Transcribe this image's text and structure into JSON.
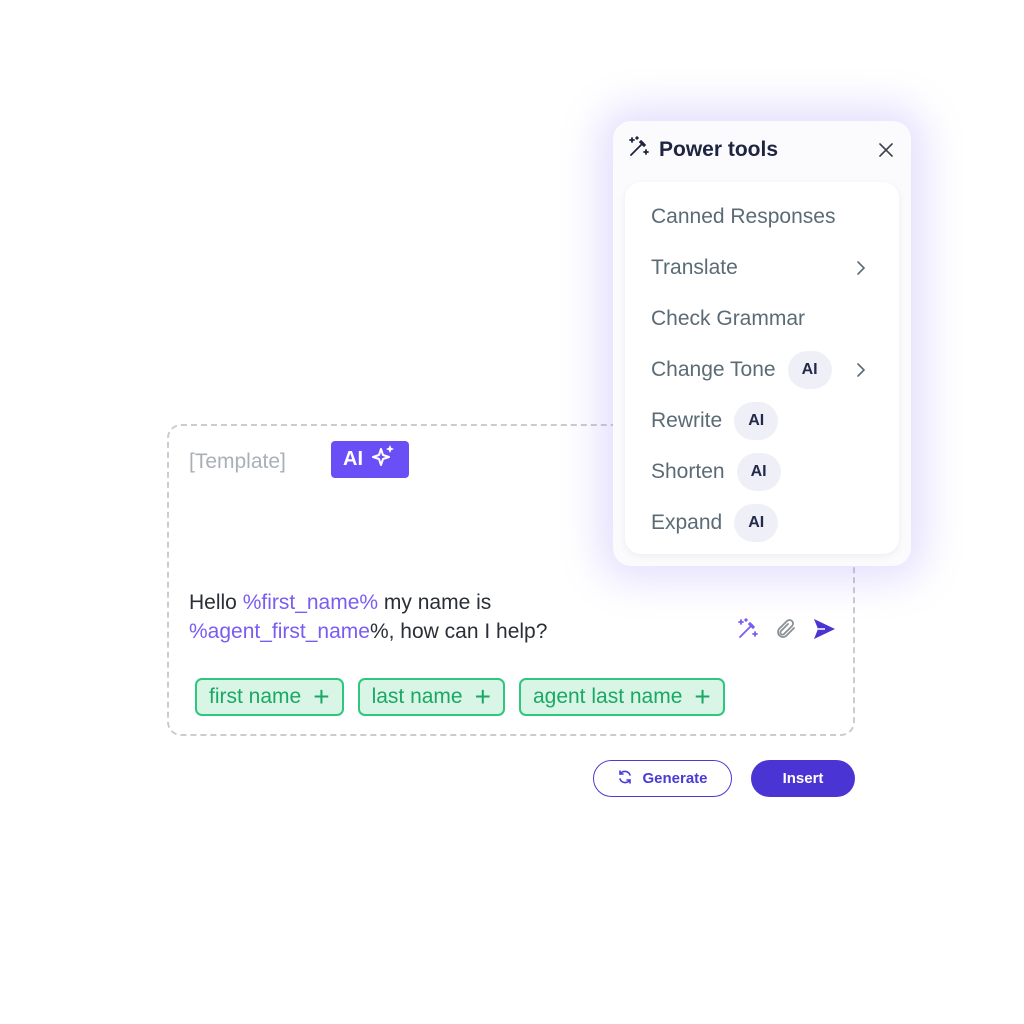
{
  "composer": {
    "template_label": "[Template]",
    "ai_chip_label": "AI",
    "message": {
      "part1": "Hello ",
      "var1": "%first_name%",
      "part2": " my name is",
      "var2": "%agent_first_name",
      "part3": "%, how can I help?"
    },
    "icons": [
      "magic-wand-icon",
      "paperclip-icon",
      "send-icon"
    ],
    "tags": [
      {
        "label": "first name",
        "icon": "plus-icon"
      },
      {
        "label": "last name",
        "icon": "plus-icon"
      },
      {
        "label": "agent last name",
        "icon": "plus-icon"
      }
    ]
  },
  "actions": {
    "generate_label": "Generate",
    "insert_label": "Insert"
  },
  "power_tools": {
    "title": "Power tools",
    "items": [
      {
        "label": "Canned Responses",
        "ai": false,
        "submenu": false
      },
      {
        "label": "Translate",
        "ai": false,
        "submenu": true
      },
      {
        "label": "Check Grammar",
        "ai": false,
        "submenu": false
      },
      {
        "label": "Change Tone",
        "ai": true,
        "submenu": true
      },
      {
        "label": "Rewrite",
        "ai": true,
        "submenu": false
      },
      {
        "label": "Shorten",
        "ai": true,
        "submenu": false
      },
      {
        "label": "Expand",
        "ai": true,
        "submenu": false
      }
    ],
    "ai_badge_label": "AI"
  },
  "colors": {
    "accent": "#6a4ff6",
    "primary_button": "#4a35d4",
    "tag_green": "#2fc77f",
    "tag_bg": "#d9f5e6",
    "variable_text": "#7b5cf2"
  }
}
